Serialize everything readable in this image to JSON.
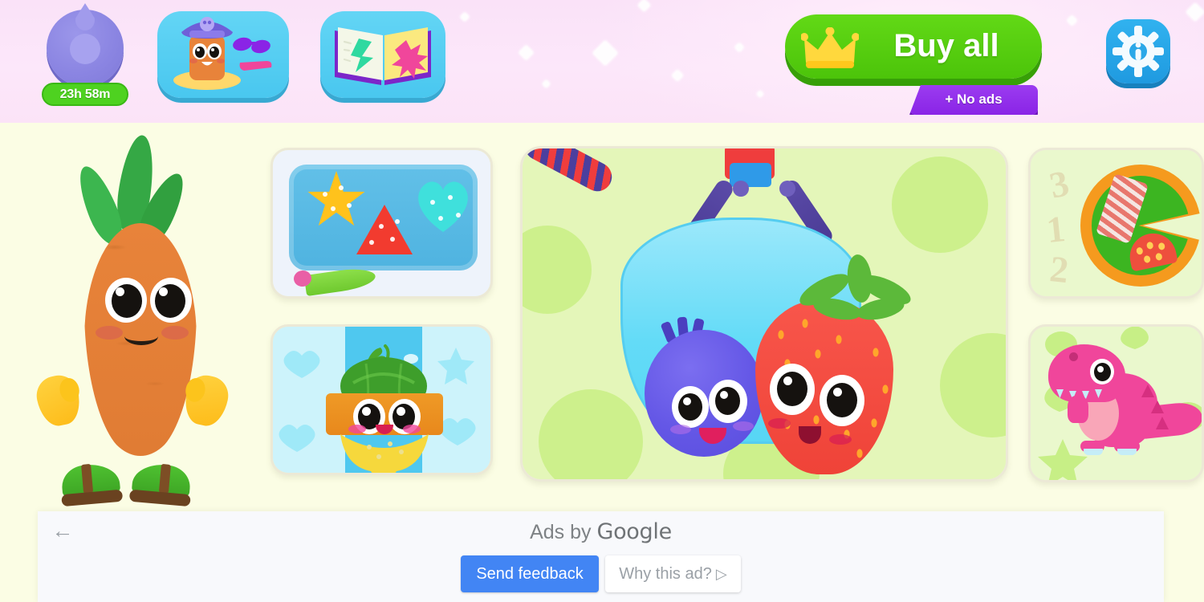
{
  "topbar": {
    "background_color": "#fbe3f7",
    "timer": {
      "icon": "locked-reward-coin-icon",
      "badge_text": "23h 58m",
      "badge_color": "#4ed220"
    },
    "dressup_button": {
      "icon": "pirate-character-dressup-icon"
    },
    "book_button": {
      "icon": "open-storybook-icon"
    },
    "buy_all": {
      "label": "Buy all",
      "sub_label": "+ No ads",
      "crown_icon": "crown-icon",
      "button_color": "#4cc40a",
      "ribbon_color": "#8a24e6"
    },
    "settings_button": {
      "icon": "gear-icon",
      "color": "#1f9ae0"
    }
  },
  "stage": {
    "background_color": "#fbfde4",
    "mascot": {
      "name": "carrot-character",
      "body_color": "#e07c34",
      "leaf_color": "#35a845",
      "mitten_color": "#fdbb18",
      "shoe_color": "#3da524"
    },
    "cards": [
      {
        "id": "cookies",
        "name": "cookie-decorating-game-card",
        "bg": "#e9f7d7"
      },
      {
        "id": "fruitmix",
        "name": "fruit-mixer-game-card",
        "bg": "#cdf3fb"
      },
      {
        "id": "hero",
        "name": "claw-machine-game-card",
        "bg": "#e4f6b9"
      },
      {
        "id": "pizza",
        "name": "pizza-counting-game-card",
        "bg": "#eaf8cd"
      },
      {
        "id": "dino",
        "name": "dinosaur-game-card",
        "bg": "#eaf8cd"
      }
    ],
    "pizza_numbers": [
      "3",
      "1",
      "2"
    ]
  },
  "ad_overlay": {
    "back_arrow": "←",
    "ads_by_prefix": "Ads by ",
    "ads_by_brand": "Google",
    "send_feedback_label": "Send feedback",
    "why_this_ad_label": "Why this ad?",
    "why_this_ad_glyph": "▷",
    "send_feedback_color": "#4285f4"
  }
}
